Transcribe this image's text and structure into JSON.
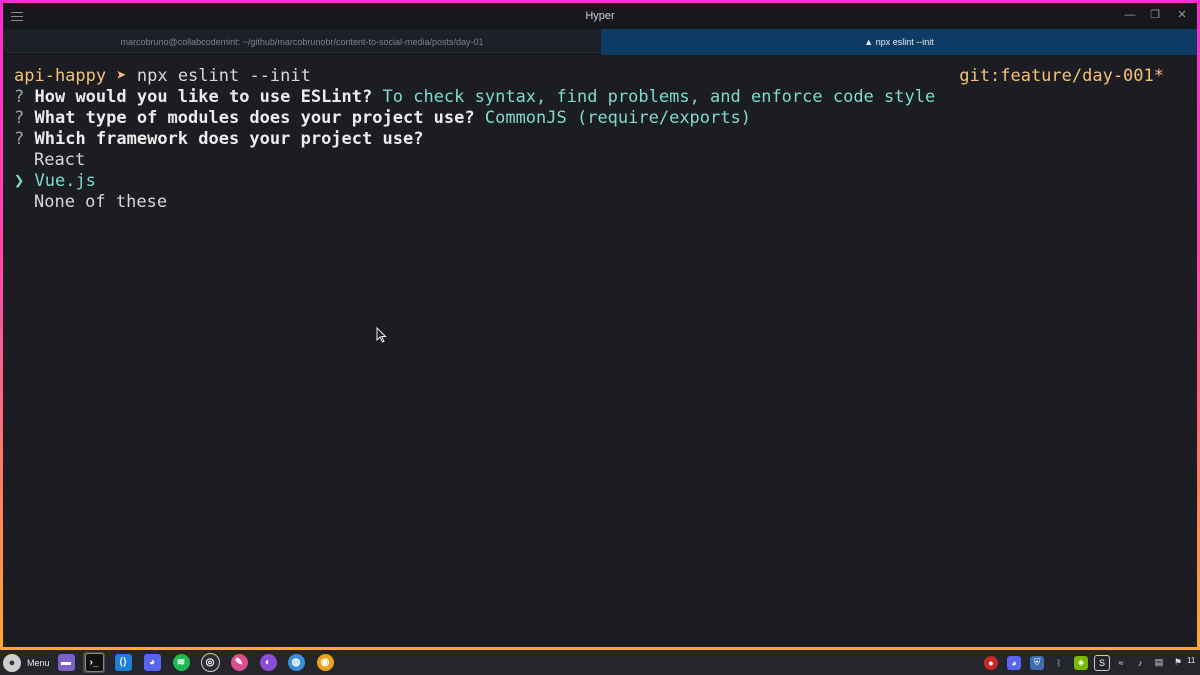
{
  "window": {
    "title": "Hyper",
    "menu_icon": "hamburger-icon",
    "minimize_glyph": "—",
    "restore_glyph": "❐",
    "close_glyph": "✕"
  },
  "tabs": [
    {
      "label": "marcobruno@collabcodemint: ~/github/marcobrunobr/content-to-social-media/posts/day-01",
      "active": false
    },
    {
      "label": "▲ npx eslint --init",
      "active": true
    }
  ],
  "terminal": {
    "prompt_dir": "api-happy",
    "prompt_arrow": "➤",
    "command": "npx eslint --init",
    "git_branch": "git:feature/day-001*",
    "q1_mark": "?",
    "q1_text": "How would you like to use ESLint?",
    "q1_answer": "To check syntax, find problems, and enforce code style",
    "q2_mark": "?",
    "q2_text": "What type of modules does your project use?",
    "q2_answer": "CommonJS (require/exports)",
    "q3_mark": "?",
    "q3_text": "Which framework does your project use?",
    "option1": "React",
    "selected_mark": "❯",
    "option2": "Vue.js",
    "option3": "None of these"
  },
  "taskbar": {
    "menu_label": "Menu",
    "apps": [
      "files-icon",
      "terminal-icon",
      "vscode-icon",
      "discord-icon",
      "spotify-icon",
      "obs-icon",
      "krita-icon",
      "firefox-icon",
      "web-icon",
      "chrome-icon"
    ],
    "tray": [
      "obs-tray-icon",
      "discord-tray-icon",
      "shield-tray-icon",
      "bluetooth-icon",
      "nvidia-icon",
      "ssh-icon",
      "wifi-icon",
      "music-icon",
      "clipboard-icon",
      "notification-icon"
    ],
    "clock": "11"
  },
  "colors": {
    "accent_pink": "#ff2bd0",
    "accent_orange": "#ffb020",
    "prompt_yellow": "#f6c177",
    "answer_cyan": "#7fdbca",
    "active_tab": "#0e3b63"
  }
}
